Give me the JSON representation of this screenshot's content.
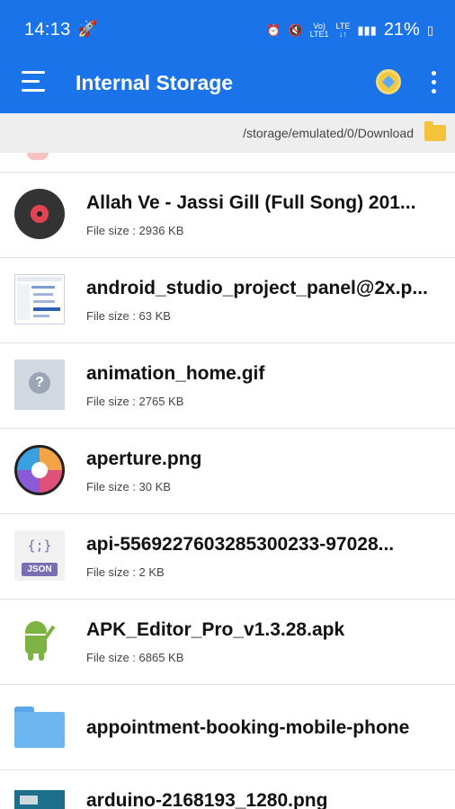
{
  "status_bar": {
    "time": "14:13",
    "battery": "21%",
    "signal_text_top": "VoLTE LTE",
    "signal_text_bottom": "LTE1"
  },
  "app_bar": {
    "title": "Internal Storage",
    "menu_icon": "hamburger-menu-icon",
    "premium_icon": "premium-diamond-icon",
    "overflow_icon": "more-vertical-icon"
  },
  "path_bar": {
    "path": "/storage/emulated/0/Download",
    "folder_icon": "folder-icon"
  },
  "files": [
    {
      "name": "Allah Ve - Jassi Gill (Full Song) 201...",
      "size": "File size : 2936 KB",
      "icon": "music-disc-icon"
    },
    {
      "name": "android_studio_project_panel@2x.p...",
      "size": "File size : 63 KB",
      "icon": "image-thumbnail-icon"
    },
    {
      "name": "animation_home.gif",
      "size": "File size : 2765 KB",
      "icon": "unknown-file-icon"
    },
    {
      "name": "aperture.png",
      "size": "File size : 30 KB",
      "icon": "aperture-image-icon"
    },
    {
      "name": "api-5569227603285300233-97028...",
      "size": "File size : 2 KB",
      "icon": "json-file-icon",
      "badge": "JSON"
    },
    {
      "name": "APK_Editor_Pro_v1.3.28.apk",
      "size": "File size : 6865 KB",
      "icon": "android-apk-icon"
    },
    {
      "name": "appointment-booking-mobile-phone",
      "size": "",
      "icon": "folder-icon"
    },
    {
      "name": "arduino-2168193_1280.png",
      "size": "",
      "icon": "arduino-image-icon"
    }
  ],
  "colors": {
    "primary": "#1a73e8",
    "path_bar_bg": "#eeeeee",
    "folder_yellow": "#f5c23c"
  }
}
